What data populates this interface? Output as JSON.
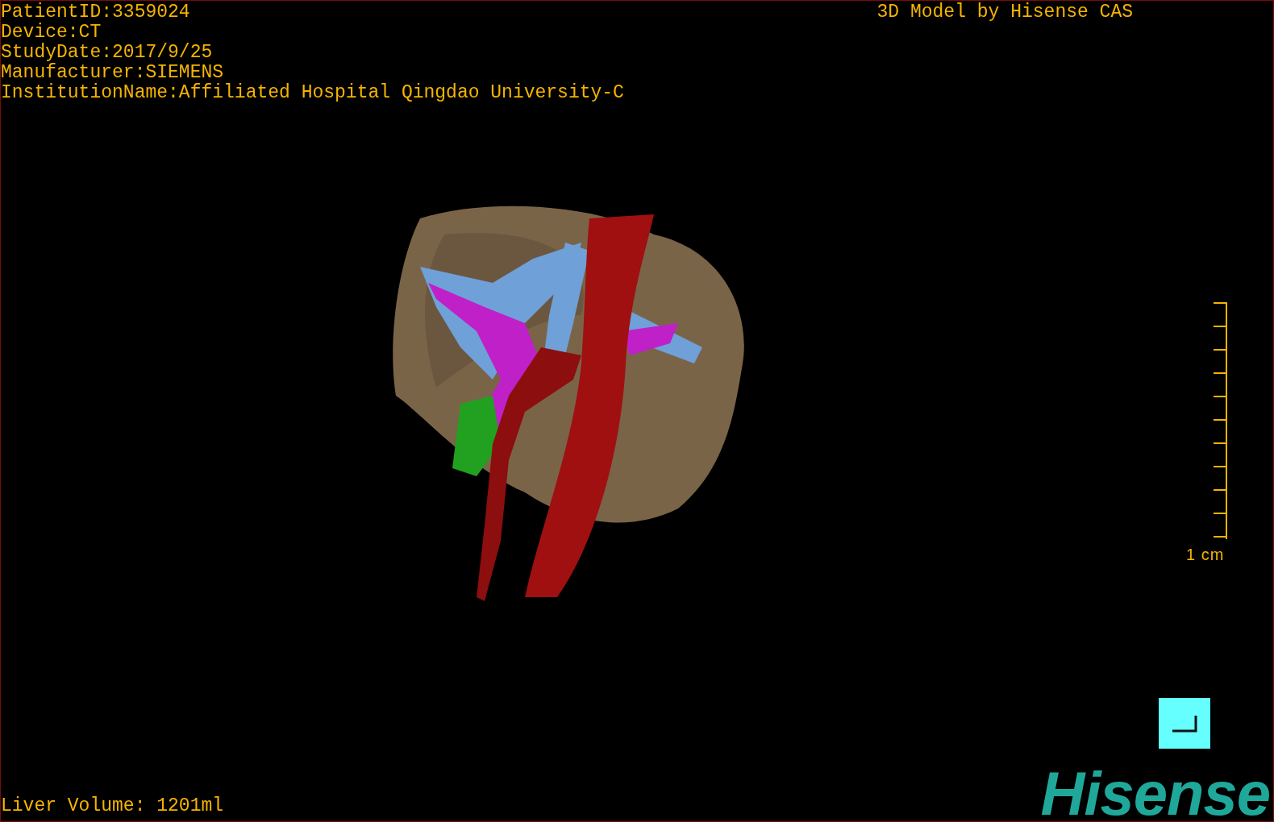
{
  "header": {
    "info": [
      "PatientID:3359024",
      "Device:CT",
      "StudyDate:2017/9/25",
      "Manufacturer:SIEMENS",
      "InstitutionName:Affiliated Hospital Qingdao University-C"
    ],
    "credit": "3D Model by Hisense CAS"
  },
  "scale": {
    "label": "1 cm"
  },
  "footer": {
    "volume": "Liver Volume: 1201ml",
    "logo": "Hisense"
  }
}
